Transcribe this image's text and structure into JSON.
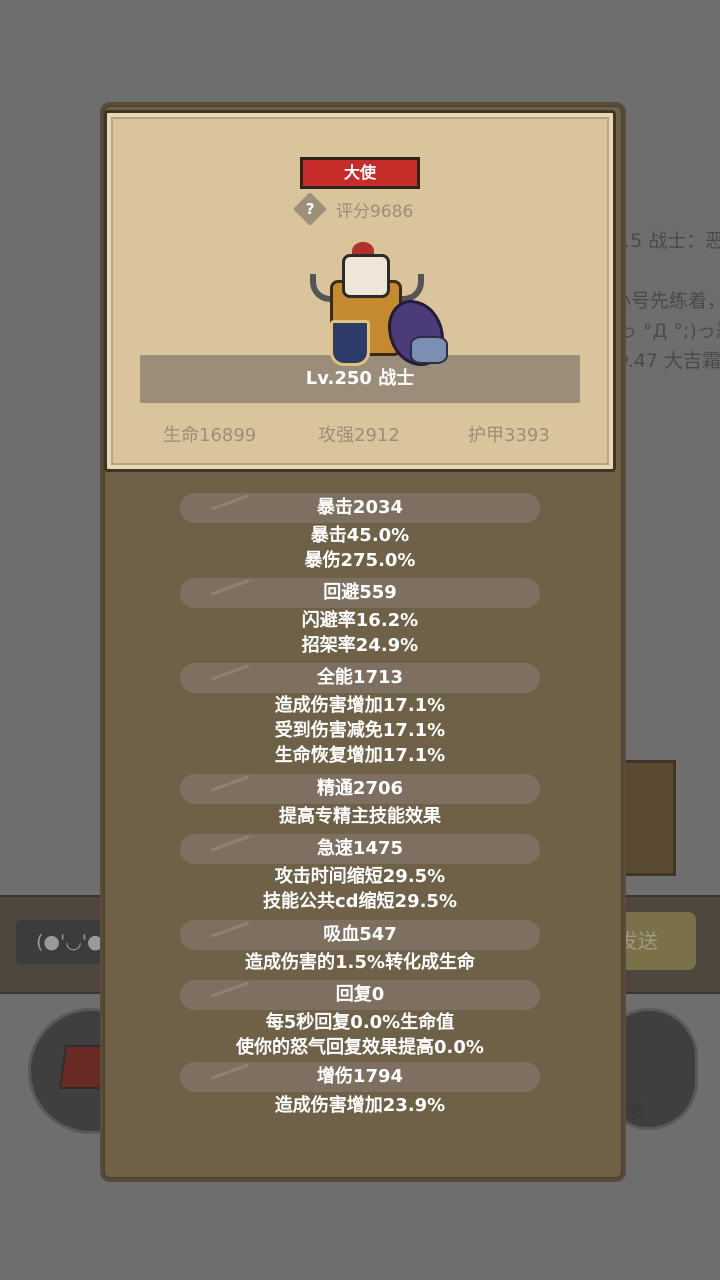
{
  "background": {
    "chat_lines": [
      "15 战士：恶",
      "小号先练着，",
      "っ °Д °;)っ恶",
      "v.47 大吉霜"
    ],
    "input_text": "(●'◡'●",
    "send_label": "发送",
    "skill_book_label": "能书"
  },
  "card": {
    "title_badge": "大使",
    "help_icon": "?",
    "score": "评分9686",
    "level_line": "Lv.250 战士",
    "stats": {
      "hp": "生命16899",
      "attack": "攻强2912",
      "armor": "护甲3393"
    }
  },
  "attributes": [
    {
      "head": "暴击2034",
      "lines": [
        "暴击45.0%",
        "暴伤275.0%"
      ]
    },
    {
      "head": "回避559",
      "lines": [
        "闪避率16.2%",
        "招架率24.9%"
      ]
    },
    {
      "head": "全能1713",
      "lines": [
        "造成伤害增加17.1%",
        "受到伤害减免17.1%",
        "生命恢复增加17.1%"
      ]
    },
    {
      "head": "精通2706",
      "lines": [
        "提高专精主技能效果"
      ]
    },
    {
      "head": "急速1475",
      "lines": [
        "攻击时间缩短29.5%",
        "技能公共cd缩短29.5%"
      ]
    },
    {
      "head": "吸血547",
      "lines": [
        "造成伤害的1.5%转化成生命"
      ]
    },
    {
      "head": "回复0",
      "lines": [
        "每5秒回复0.0%生命值",
        "使你的怒气回复效果提高0.0%"
      ]
    },
    {
      "head": "增伤1794",
      "lines": [
        "造成伤害增加23.9%"
      ]
    }
  ],
  "colors": {
    "badge_red": "#c62d2a",
    "panel_brown": "#6f6048",
    "card_parchment": "#d9c49c"
  }
}
